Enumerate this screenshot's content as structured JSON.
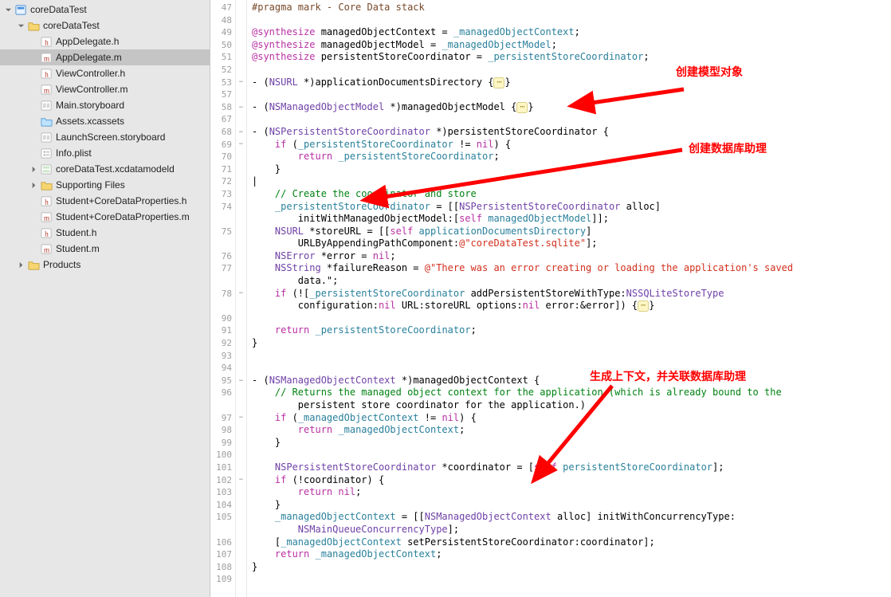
{
  "sidebar": {
    "items": [
      {
        "label": "coreDataTest",
        "depth": 0,
        "icon": "proj",
        "disclosure": "down",
        "sel": false
      },
      {
        "label": "coreDataTest",
        "depth": 1,
        "icon": "folder",
        "disclosure": "down",
        "sel": false
      },
      {
        "label": "AppDelegate.h",
        "depth": 2,
        "icon": "h",
        "disclosure": "none",
        "sel": false
      },
      {
        "label": "AppDelegate.m",
        "depth": 2,
        "icon": "m",
        "disclosure": "none",
        "sel": true
      },
      {
        "label": "ViewController.h",
        "depth": 2,
        "icon": "h",
        "disclosure": "none",
        "sel": false
      },
      {
        "label": "ViewController.m",
        "depth": 2,
        "icon": "m",
        "disclosure": "none",
        "sel": false
      },
      {
        "label": "Main.storyboard",
        "depth": 2,
        "icon": "storyboard",
        "disclosure": "none",
        "sel": false
      },
      {
        "label": "Assets.xcassets",
        "depth": 2,
        "icon": "assets",
        "disclosure": "none",
        "sel": false
      },
      {
        "label": "LaunchScreen.storyboard",
        "depth": 2,
        "icon": "storyboard",
        "disclosure": "none",
        "sel": false
      },
      {
        "label": "Info.plist",
        "depth": 2,
        "icon": "plist",
        "disclosure": "none",
        "sel": false
      },
      {
        "label": "coreDataTest.xcdatamodeld",
        "depth": 2,
        "icon": "datamodel",
        "disclosure": "right",
        "sel": false
      },
      {
        "label": "Supporting Files",
        "depth": 2,
        "icon": "folder",
        "disclosure": "right",
        "sel": false
      },
      {
        "label": "Student+CoreDataProperties.h",
        "depth": 2,
        "icon": "h",
        "disclosure": "none",
        "sel": false
      },
      {
        "label": "Student+CoreDataProperties.m",
        "depth": 2,
        "icon": "m",
        "disclosure": "none",
        "sel": false
      },
      {
        "label": "Student.h",
        "depth": 2,
        "icon": "h",
        "disclosure": "none",
        "sel": false
      },
      {
        "label": "Student.m",
        "depth": 2,
        "icon": "m",
        "disclosure": "none",
        "sel": false
      },
      {
        "label": "Products",
        "depth": 1,
        "icon": "folder",
        "disclosure": "right",
        "sel": false
      }
    ]
  },
  "editor": {
    "lines": [
      {
        "n": 47,
        "fold": "",
        "html": "<span class='prag'>#pragma mark - Core Data stack</span>"
      },
      {
        "n": 48,
        "fold": "",
        "html": ""
      },
      {
        "n": 49,
        "fold": "",
        "html": "<span class='kw'>@synthesize</span> managedObjectContext = <span class='utype'>_managedObjectContext</span>;"
      },
      {
        "n": 50,
        "fold": "",
        "html": "<span class='kw'>@synthesize</span> managedObjectModel = <span class='utype'>_managedObjectModel</span>;"
      },
      {
        "n": 51,
        "fold": "",
        "html": "<span class='kw'>@synthesize</span> persistentStoreCoordinator = <span class='utype'>_persistentStoreCoordinator</span>;"
      },
      {
        "n": 52,
        "fold": "",
        "html": ""
      },
      {
        "n": 53,
        "fold": "-",
        "html": "- (<span class='type'>NSURL</span> *)applicationDocumentsDirectory {<span class='fold'>⋯</span>}"
      },
      {
        "n": 57,
        "fold": "",
        "html": ""
      },
      {
        "n": 58,
        "fold": "-",
        "html": "- (<span class='type'>NSManagedObjectModel</span> *)managedObjectModel {<span class='fold'>⋯</span>}"
      },
      {
        "n": 67,
        "fold": "",
        "html": ""
      },
      {
        "n": 68,
        "fold": "-",
        "html": "- (<span class='type'>NSPersistentStoreCoordinator</span> *)persistentStoreCoordinator {"
      },
      {
        "n": 69,
        "fold": "-",
        "html": "    <span class='kw'>if</span> (<span class='utype'>_persistentStoreCoordinator</span> != <span class='kw'>nil</span>) {"
      },
      {
        "n": 70,
        "fold": "",
        "html": "        <span class='kw'>return</span> <span class='utype'>_persistentStoreCoordinator</span>;"
      },
      {
        "n": 71,
        "fold": "",
        "html": "    }"
      },
      {
        "n": 72,
        "fold": "",
        "html": "|"
      },
      {
        "n": 73,
        "fold": "",
        "html": "    <span class='cmt'>// Create the coordinator and store</span>"
      },
      {
        "n": 74,
        "fold": "",
        "html": "    <span class='utype'>_persistentStoreCoordinator</span> = [[<span class='type'>NSPersistentStoreCoordinator</span> <span class='sel'>alloc</span>]\n        <span class='sel'>initWithManagedObjectModel</span>:[<span class='kw'>self</span> <span class='utype'>managedObjectModel</span>]];"
      },
      {
        "n": 75,
        "fold": "",
        "html": "    <span class='type'>NSURL</span> *storeURL = [[<span class='kw'>self</span> <span class='utype'>applicationDocumentsDirectory</span>]\n        <span class='sel'>URLByAppendingPathComponent</span>:<span class='str'>@\"coreDataTest.sqlite\"</span>];"
      },
      {
        "n": 76,
        "fold": "",
        "html": "    <span class='type'>NSError</span> *error = <span class='kw'>nil</span>;"
      },
      {
        "n": 77,
        "fold": "",
        "html": "    <span class='type'>NSString</span> *failureReason = <span class='str'>@\"There was an error creating or loading the application's saved\n        data.\"</span>;"
      },
      {
        "n": 78,
        "fold": "-",
        "html": "    <span class='kw'>if</span> (![<span class='utype'>_persistentStoreCoordinator</span> <span class='sel'>addPersistentStoreWithType</span>:<span class='type'>NSSQLiteStoreType</span>\n        <span class='sel'>configuration</span>:<span class='kw'>nil</span> <span class='sel'>URL</span>:storeURL <span class='sel'>options</span>:<span class='kw'>nil</span> <span class='sel'>error</span>:&amp;error]) {<span class='fold'>⋯</span>}"
      },
      {
        "n": 90,
        "fold": "",
        "html": ""
      },
      {
        "n": 91,
        "fold": "",
        "html": "    <span class='kw'>return</span> <span class='utype'>_persistentStoreCoordinator</span>;"
      },
      {
        "n": 92,
        "fold": "",
        "html": "}"
      },
      {
        "n": 93,
        "fold": "",
        "html": ""
      },
      {
        "n": 94,
        "fold": "",
        "html": ""
      },
      {
        "n": 95,
        "fold": "-",
        "html": "- (<span class='type'>NSManagedObjectContext</span> *)managedObjectContext {"
      },
      {
        "n": 96,
        "fold": "",
        "html": "    <span class='cmt'>// Returns the managed object context for the application (which is already bound to the\n        persistent store coordinator for the application.)</span>"
      },
      {
        "n": 97,
        "fold": "-",
        "html": "    <span class='kw'>if</span> (<span class='utype'>_managedObjectContext</span> != <span class='kw'>nil</span>) {"
      },
      {
        "n": 98,
        "fold": "",
        "html": "        <span class='kw'>return</span> <span class='utype'>_managedObjectContext</span>;"
      },
      {
        "n": 99,
        "fold": "",
        "html": "    }"
      },
      {
        "n": 100,
        "fold": "",
        "html": ""
      },
      {
        "n": 101,
        "fold": "",
        "html": "    <span class='type'>NSPersistentStoreCoordinator</span> *coordinator = [<span class='kw'>self</span> <span class='utype'>persistentStoreCoordinator</span>];"
      },
      {
        "n": 102,
        "fold": "-",
        "html": "    <span class='kw'>if</span> (!coordinator) {"
      },
      {
        "n": 103,
        "fold": "",
        "html": "        <span class='kw'>return</span> <span class='kw'>nil</span>;"
      },
      {
        "n": 104,
        "fold": "",
        "html": "    }"
      },
      {
        "n": 105,
        "fold": "",
        "html": "    <span class='utype'>_managedObjectContext</span> = [[<span class='type'>NSManagedObjectContext</span> <span class='sel'>alloc</span>] <span class='sel'>initWithConcurrencyType</span>:\n        <span class='type'>NSMainQueueConcurrencyType</span>];"
      },
      {
        "n": 106,
        "fold": "",
        "html": "    [<span class='utype'>_managedObjectContext</span> <span class='sel'>setPersistentStoreCoordinator</span>:coordinator];"
      },
      {
        "n": 107,
        "fold": "",
        "html": "    <span class='kw'>return</span> <span class='utype'>_managedObjectContext</span>;"
      },
      {
        "n": 108,
        "fold": "",
        "html": "}"
      },
      {
        "n": 109,
        "fold": "",
        "html": ""
      }
    ]
  },
  "annotations": {
    "a1": "创建模型对象",
    "a2": "创建数据库助理",
    "a3": "生成上下文，并关联数据库助理"
  }
}
